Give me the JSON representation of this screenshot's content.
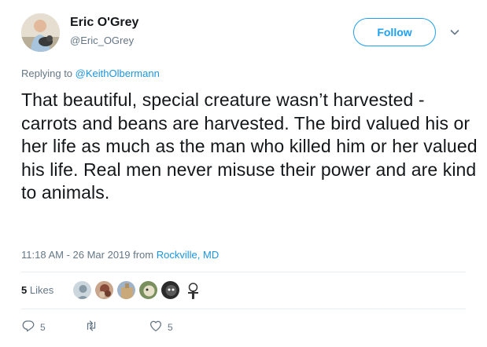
{
  "author": {
    "name": "Eric O'Grey",
    "handle": "@Eric_OGrey"
  },
  "follow_label": "Follow",
  "reply_prefix": "Replying to",
  "reply_to": "@KeithOlbermann",
  "tweet_text": "That beautiful, special creature wasn’t harvested - carrots and beans are harvested. The bird valued his or her life as much as the man who killed him or her valued his life. Real men never misuse their power and are kind to animals.",
  "timestamp": "11:18 AM - 26 Mar 2019 from",
  "location": "Rockville, MD",
  "likes": {
    "count": "5",
    "label": "Likes"
  },
  "actions": {
    "reply_count": "5",
    "retweet_count": "",
    "like_count": "5"
  },
  "icons": [
    "chevron-down-icon",
    "reply-icon",
    "retweet-icon",
    "heart-icon"
  ],
  "colors": {
    "accent": "#1da1f2",
    "link": "#1b95e0",
    "muted": "#657786",
    "text": "#14171a"
  }
}
